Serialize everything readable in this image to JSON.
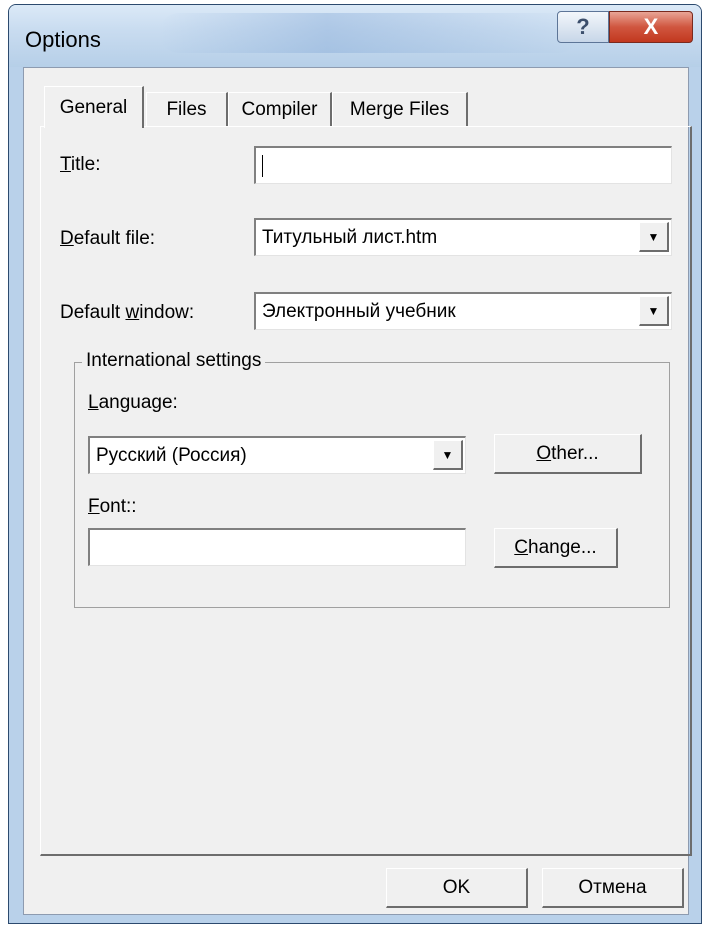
{
  "window": {
    "title": "Options",
    "help_label": "?",
    "close_label": "X"
  },
  "tabs": [
    {
      "label": "General"
    },
    {
      "label": "Files"
    },
    {
      "label": "Compiler"
    },
    {
      "label": "Merge Files"
    }
  ],
  "general": {
    "title_label": "Title:",
    "title_value": "",
    "default_file_label": "Default file:",
    "default_file_value": "Титульный лист.htm",
    "default_window_label": "Default window:",
    "default_window_value": "Электронный учебник"
  },
  "international": {
    "group_label": "International settings",
    "language_label": "Language:",
    "language_value": "Русский (Россия)",
    "other_button": "Other...",
    "font_label": "Font::",
    "font_value": "",
    "change_button": "Change..."
  },
  "footer": {
    "ok_button": "OK",
    "cancel_button": "Отмена"
  },
  "colors": {
    "close_button": "#c94a33",
    "dialog_background": "#f0f0f0",
    "frame": "#b9d1ea"
  },
  "icons": {
    "dropdown": "triangle-down-icon"
  }
}
